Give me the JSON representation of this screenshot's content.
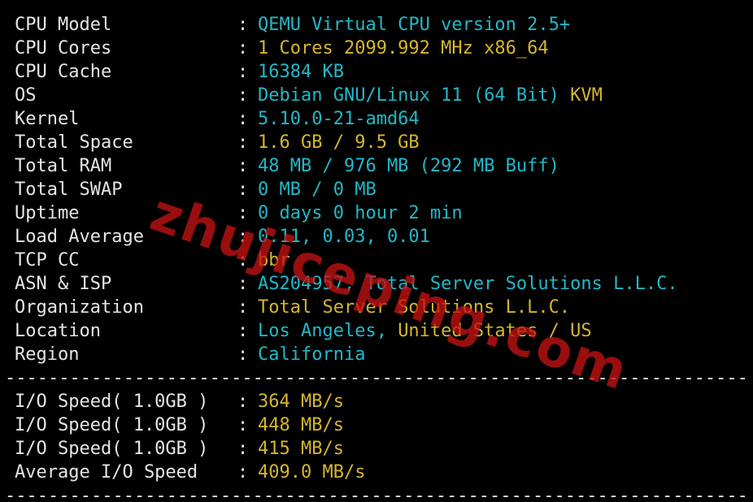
{
  "colors": {
    "background": "#000000",
    "label": "#e6e6e6",
    "cyan": "#22b8c8",
    "yellow": "#d6b630",
    "watermark": "#c41212"
  },
  "separator": "--------------------------------------------------------------------",
  "top_rule": "----------------------------------------------------------------------",
  "colon": ":",
  "system": [
    {
      "label": "CPU Model",
      "parts": [
        {
          "text": "QEMU Virtual CPU version 2.5+",
          "color": "cyan"
        }
      ]
    },
    {
      "label": "CPU Cores",
      "parts": [
        {
          "text": "1 Cores 2099.992 MHz x86_64",
          "color": "yellow"
        }
      ]
    },
    {
      "label": "CPU Cache",
      "parts": [
        {
          "text": "16384 KB",
          "color": "cyan"
        }
      ]
    },
    {
      "label": "OS",
      "parts": [
        {
          "text": "Debian GNU/Linux 11 (64 Bit) ",
          "color": "cyan"
        },
        {
          "text": "KVM",
          "color": "yellow"
        }
      ]
    },
    {
      "label": "Kernel",
      "parts": [
        {
          "text": "5.10.0-21-amd64",
          "color": "cyan"
        }
      ]
    },
    {
      "label": "Total Space",
      "parts": [
        {
          "text": "1.6 GB / 9.5 GB",
          "color": "yellow"
        }
      ]
    },
    {
      "label": "Total RAM",
      "parts": [
        {
          "text": "48 MB / 976 MB (292 MB Buff)",
          "color": "cyan"
        }
      ]
    },
    {
      "label": "Total SWAP",
      "parts": [
        {
          "text": "0 MB / 0 MB",
          "color": "cyan"
        }
      ]
    },
    {
      "label": "Uptime",
      "parts": [
        {
          "text": "0 days 0 hour 2 min",
          "color": "cyan"
        }
      ]
    },
    {
      "label": "Load Average",
      "parts": [
        {
          "text": "0.11, 0.03, 0.01",
          "color": "cyan"
        }
      ]
    },
    {
      "label": "TCP CC",
      "parts": [
        {
          "text": "bbr",
          "color": "yellow"
        }
      ]
    },
    {
      "label": "ASN & ISP",
      "parts": [
        {
          "text": "AS204957, Total Server Solutions L.L.C.",
          "color": "cyan"
        }
      ]
    },
    {
      "label": "Organization",
      "parts": [
        {
          "text": "Total Server Solutions L.L.C.",
          "color": "yellow"
        }
      ]
    },
    {
      "label": "Location",
      "parts": [
        {
          "text": "Los Angeles, ",
          "color": "cyan"
        },
        {
          "text": "United States / US",
          "color": "yellow"
        }
      ]
    },
    {
      "label": "Region",
      "parts": [
        {
          "text": "California",
          "color": "cyan"
        }
      ]
    }
  ],
  "io": [
    {
      "label": "I/O Speed( 1.0GB )",
      "parts": [
        {
          "text": "364 MB/s",
          "color": "yellow"
        }
      ]
    },
    {
      "label": "I/O Speed( 1.0GB )",
      "parts": [
        {
          "text": "448 MB/s",
          "color": "yellow"
        }
      ]
    },
    {
      "label": "I/O Speed( 1.0GB )",
      "parts": [
        {
          "text": "415 MB/s",
          "color": "yellow"
        }
      ]
    },
    {
      "label": "Average I/O Speed",
      "parts": [
        {
          "text": "409.0 MB/s",
          "color": "yellow"
        }
      ]
    }
  ],
  "watermark": "zhujiceping.com"
}
